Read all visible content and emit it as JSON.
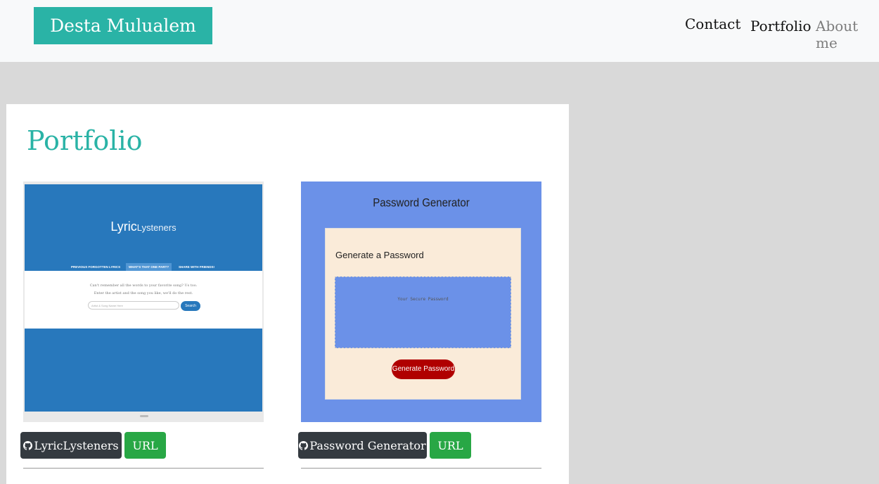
{
  "navbar": {
    "brand": "Desta Mulualem",
    "links": [
      "Contact",
      "Portfolio",
      "About me"
    ]
  },
  "main": {
    "title": "Portfolio",
    "projects": [
      {
        "name": "LyricLysteners",
        "url_label": "URL",
        "icon": "github-icon",
        "preview": {
          "logo_main": "Lyric",
          "logo_sub": "Lysteners",
          "nav": [
            "PREVIOUS FORGOTTEN LYRICS",
            "WHAT'S THAT ONE PART?",
            "SHARE WITH FRIENDS!"
          ],
          "line1": "Can't remember all the words to your favorite song? Us too.",
          "line2": "Enter the artist and the song you like, we'll do the rest.",
          "input_placeholder": "Artist & Song Name Here",
          "button": "Search"
        }
      },
      {
        "name": "Password Generator",
        "url_label": "URL",
        "icon": "github-icon",
        "preview": {
          "title": "Password Generator",
          "subtitle": "Generate a Password",
          "placeholder": "Your Secure Password",
          "button": "Generate Password"
        }
      }
    ]
  },
  "colors": {
    "accent": "#2ab3a6",
    "dark_button": "#343a40",
    "green_button": "#28a745",
    "lyric_blue": "#2878bc",
    "password_blue": "#6b91e8"
  }
}
